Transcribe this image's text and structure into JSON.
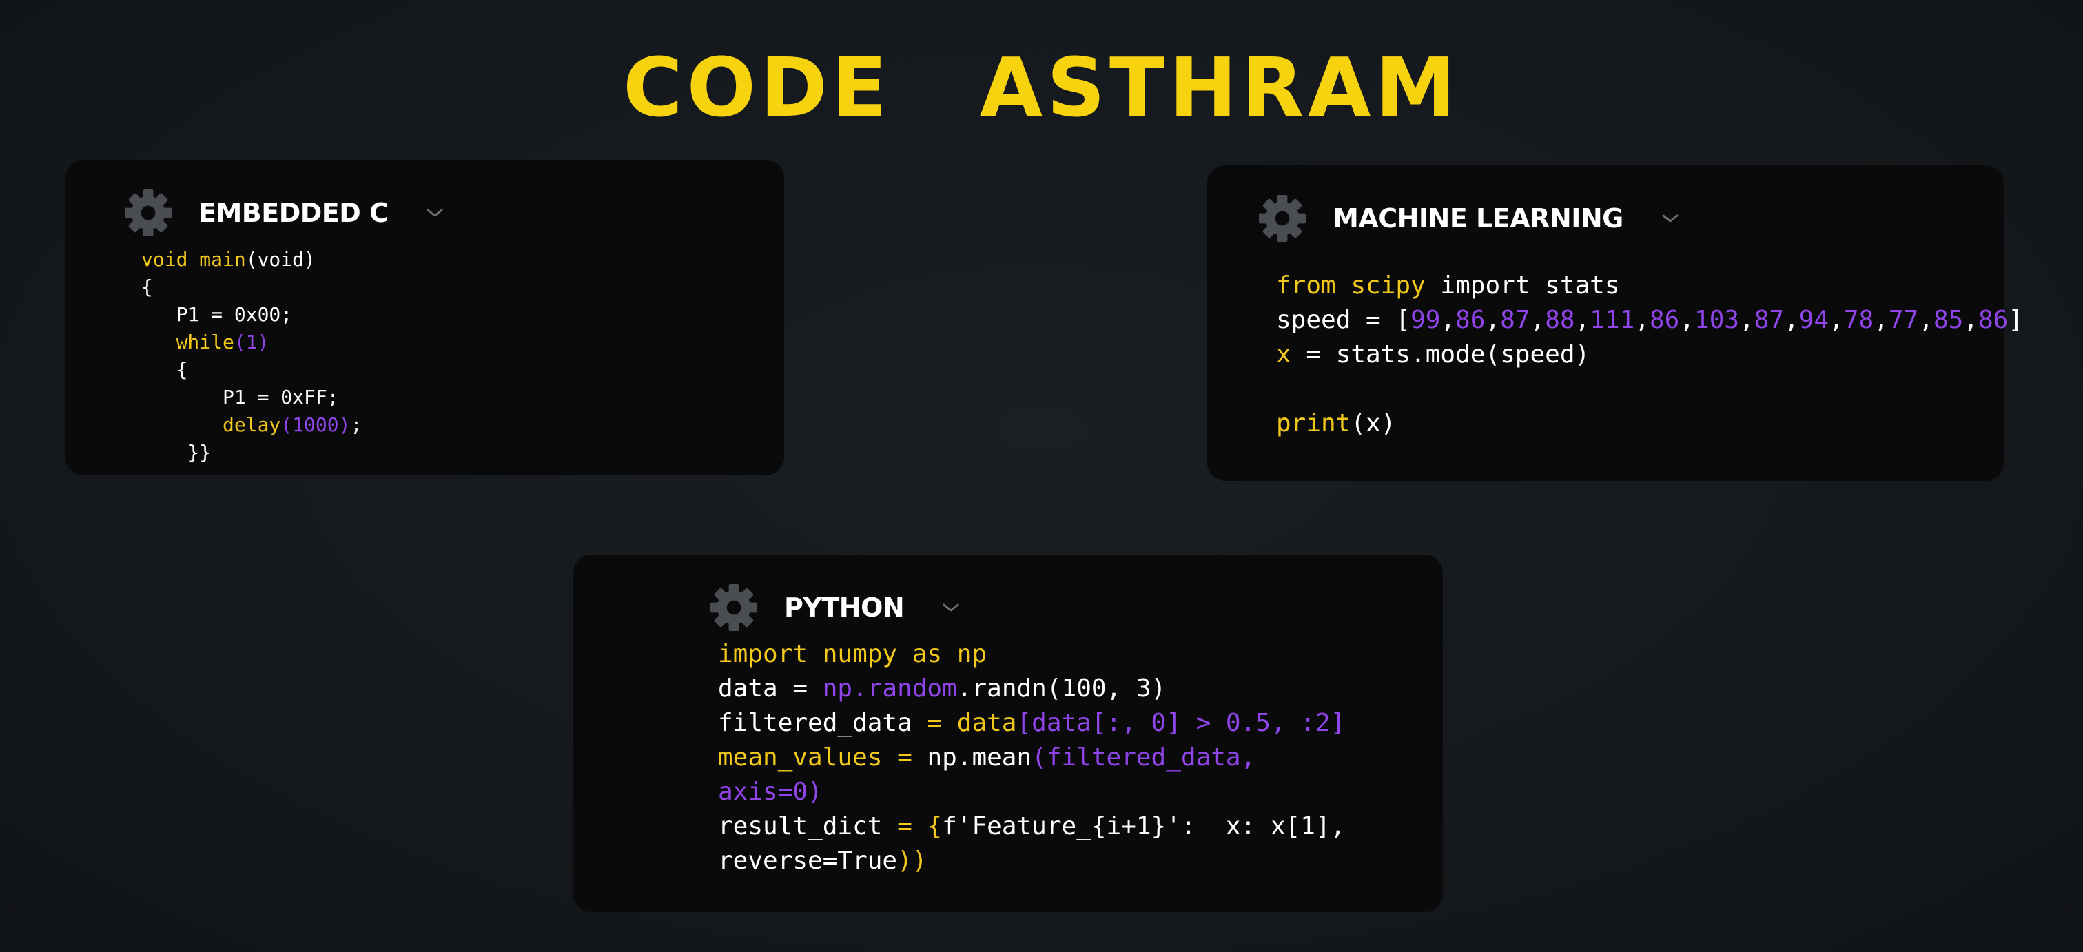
{
  "logo": {
    "left": "CODE",
    "right": "ASTHRAM",
    "color": "#f7d20f"
  },
  "colors": {
    "keyword_yellow": "#f2c91a",
    "value_purple": "#8f45ea",
    "text_white": "#ffffff",
    "card_bg": "#0a0a0a",
    "gear_gray": "#4a4d52"
  },
  "cards": {
    "embedded_c": {
      "title": "EMBEDDED C",
      "icon": "gear-icon",
      "dropdown_icon": "chevron-down-icon",
      "code": [
        {
          "t1": "void main",
          "t2": "(void)"
        },
        {
          "t1": "{"
        },
        {
          "t1": "   P1 = 0x00;"
        },
        {
          "t1": "   while",
          "t2": "(1)"
        },
        {
          "t1": "   {"
        },
        {
          "t1": "       P1 = 0xFF;"
        },
        {
          "t1": "       delay",
          "t2": "(1000)",
          "t3": ";"
        },
        {
          "t1": "    }}"
        }
      ]
    },
    "machine_learning": {
      "title": "MACHINE LEARNING",
      "icon": "gear-icon",
      "dropdown_icon": "chevron-down-icon",
      "code": {
        "line1": {
          "kw": "from scipy",
          "rest": " import stats"
        },
        "line2": {
          "prefix": "speed = [",
          "values": [
            "99",
            "86",
            "87",
            "88",
            "111",
            "86",
            "103",
            "87",
            "94",
            "78",
            "77",
            "85",
            "86"
          ],
          "suffix": "]"
        },
        "line3": {
          "var": "x",
          "rest": " = stats.mode(speed)"
        },
        "line5": {
          "fn": "print",
          "rest": "(x)"
        }
      }
    },
    "python": {
      "title": "PYTHON",
      "icon": "gear-icon",
      "dropdown_icon": "chevron-down-icon",
      "code": {
        "l1": "import numpy as np",
        "l2a": "data = ",
        "l2b": "np.random",
        "l2c": ".randn(100, 3)",
        "l3a": "filtered_data ",
        "l3b": "= data",
        "l3c": "[data[:, 0] > 0.5, :2]",
        "l4a": "mean_values = ",
        "l4b": "np.mean",
        "l4c": "(filtered_data,",
        "l5": "axis=0)",
        "l6a": "result_dict ",
        "l6b": "= {",
        "l6c": "f'Feature_{i+1}':  x: x[1],",
        "l7a": "reverse=True",
        "l7b": "))"
      }
    }
  }
}
